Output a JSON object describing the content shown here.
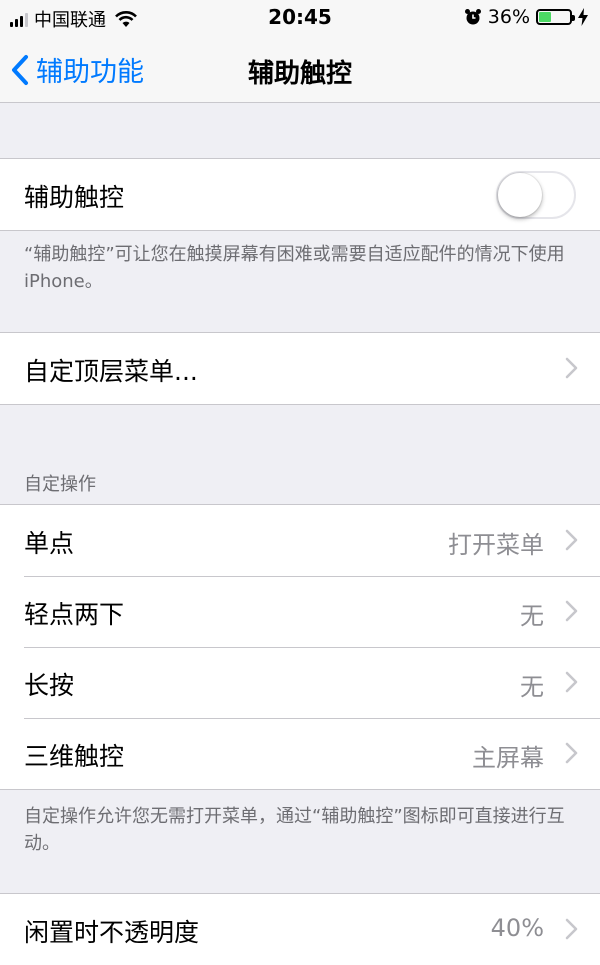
{
  "status_bar": {
    "carrier": "中国联通",
    "time": "20:45",
    "battery_percent_text": "36%",
    "battery_level": 0.36,
    "battery_color": "#4cd964"
  },
  "nav": {
    "back_label": "辅助功能",
    "title": "辅助触控",
    "accent_color": "#007aff"
  },
  "assistive_touch": {
    "label": "辅助触控",
    "enabled": false,
    "footer": "“辅助触控”可让您在触摸屏幕有困难或需要自适应配件的情况下使用 iPhone。"
  },
  "custom_menu": {
    "label": "自定顶层菜单..."
  },
  "custom_actions": {
    "header": "自定操作",
    "rows": [
      {
        "label": "单点",
        "value": "打开菜单"
      },
      {
        "label": "轻点两下",
        "value": "无"
      },
      {
        "label": "长按",
        "value": "无"
      },
      {
        "label": "三维触控",
        "value": "主屏幕"
      }
    ],
    "footer": "自定操作允许您无需打开菜单，通过“辅助触控”图标即可直接进行互动。"
  },
  "idle_opacity": {
    "label": "闲置时不透明度",
    "value": "40%"
  }
}
